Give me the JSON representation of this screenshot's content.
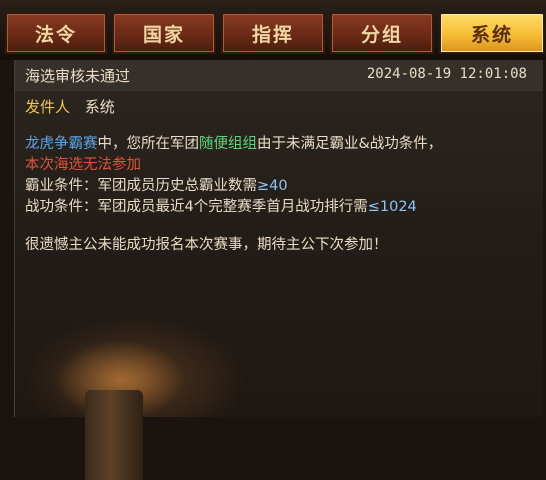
{
  "tabs": [
    {
      "label": "法令",
      "active": false
    },
    {
      "label": "国家",
      "active": false
    },
    {
      "label": "指挥",
      "active": false
    },
    {
      "label": "分组",
      "active": false
    },
    {
      "label": "系统",
      "active": true
    }
  ],
  "mail": {
    "title": "海选审核未通过",
    "date": "2024-08-19 12:01:08",
    "sender_label": "发件人",
    "sender_value": "系统",
    "line1": {
      "event": "龙虎争霸赛",
      "part2": "中，您所在军团",
      "group": "随便组组",
      "part4": "由于未满足霸业&战功条件，"
    },
    "line2": "本次海选无法参加",
    "line3": {
      "text": "霸业条件：军团成员历史总霸业数需",
      "value": "≥40"
    },
    "line4": {
      "text": "战功条件：军团成员最近4个完整赛季首月战功排行需",
      "value": "≤1024"
    },
    "closing": "很遗憾主公未能成功报名本次赛事，期待主公下次参加！"
  },
  "colors": {
    "active_tab": "#f6bd35",
    "inactive_tab": "#6a2a16",
    "highlight_blue": "#5aa5ea",
    "highlight_green": "#5fd47a",
    "warning_red": "#e0523a",
    "sender_label": "#f0c64a"
  }
}
